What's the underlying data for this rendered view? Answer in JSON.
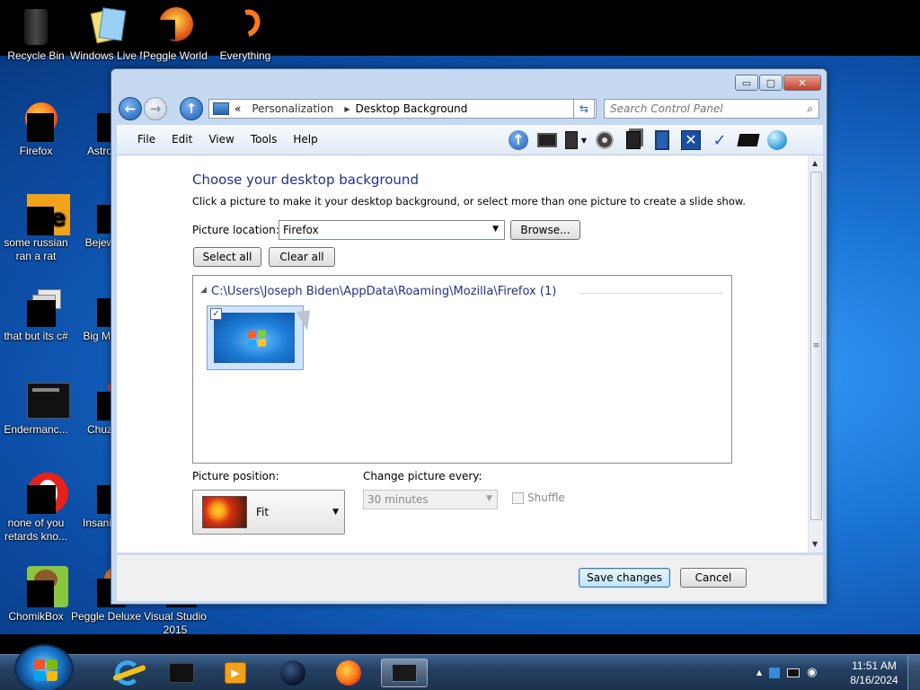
{
  "desktop": {
    "icons": [
      {
        "name": "recycle-bin",
        "label": "Recycle Bin",
        "icon": "recycle-bin-icon"
      },
      {
        "name": "windows-live-movie-maker",
        "label": "Windows Live Ma",
        "icon": "movie-maker-icon"
      },
      {
        "name": "peggle-world",
        "label": "Peggle World",
        "icon": "peggle-icon"
      },
      {
        "name": "everything",
        "label": "Everything",
        "icon": "everything-icon"
      },
      {
        "name": "firefox",
        "label": "Firefox",
        "icon": "firefox-icon"
      },
      {
        "name": "astro-deluxe",
        "label": "Astro Delu",
        "icon": "game-icon"
      },
      {
        "name": "some-russian",
        "label": "some russian",
        "label2": "ran a rat",
        "icon": "text-file-icon"
      },
      {
        "name": "bejeweled-deluxe",
        "label": "Bejew Delu",
        "icon": "game-icon"
      },
      {
        "name": "that-but-its-c",
        "label": "that but its c#",
        "icon": "windows-stack-icon"
      },
      {
        "name": "big-money-deluxe",
        "label": "Big Mo Delu",
        "icon": "game-icon"
      },
      {
        "name": "endermanch",
        "label": "Endermanc...",
        "icon": "program-icon"
      },
      {
        "name": "chuzzle-deluxe",
        "label": "Chuz Delu",
        "icon": "game-icon"
      },
      {
        "name": "none-of-you",
        "label": "none of you",
        "label2": "retards kno...",
        "icon": "opera-icon"
      },
      {
        "name": "insaniquarium-deluxe",
        "label": "Insaniq Delu",
        "icon": "game-icon"
      },
      {
        "name": "chomikbox",
        "label": "ChomikBox",
        "icon": "chomikbox-icon"
      },
      {
        "name": "peggle-deluxe",
        "label": "Peggle Deluxe",
        "icon": "peggle-icon"
      },
      {
        "name": "visual-studio-2015",
        "label": "Visual Studio",
        "label2": "2015",
        "icon": "visual-studio-icon"
      }
    ]
  },
  "window": {
    "title_buttons": {
      "minimize": "▭",
      "maximize": "▢",
      "close": "✕"
    },
    "address": {
      "prefix": "«",
      "crumb1": "Personalization",
      "separator": "▶",
      "crumb2": "Desktop Background"
    },
    "search": {
      "placeholder": "Search Control Panel"
    },
    "menu": [
      "File",
      "Edit",
      "View",
      "Tools",
      "Help"
    ],
    "content": {
      "heading": "Choose your desktop background",
      "subtext": "Click a picture to make it your desktop background, or select more than one picture to create a slide show.",
      "picture_location_label": "Picture location:",
      "picture_location_value": "Firefox",
      "browse_label": "Browse...",
      "select_all_label": "Select all",
      "clear_all_label": "Clear all",
      "group_path": "C:\\Users\\Joseph Biden\\AppData\\Roaming\\Mozilla\\Firefox (1)",
      "thumbnail_checked": "✓",
      "picture_position_label": "Picture position:",
      "picture_position_value": "Fit",
      "change_picture_label": "Change picture every:",
      "change_picture_value": "30 minutes",
      "shuffle_label": "Shuffle"
    },
    "footer": {
      "save_label": "Save changes",
      "cancel_label": "Cancel"
    }
  },
  "taskbar": {
    "clock_time": "11:51 AM",
    "clock_date": "8/16/2024",
    "tray_chevron": "▲"
  }
}
